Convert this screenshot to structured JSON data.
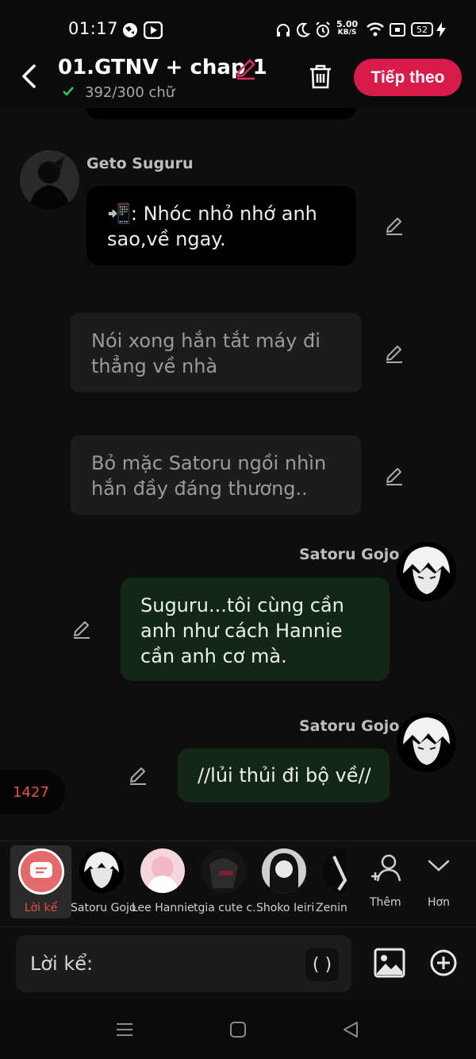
{
  "status_bar": {
    "time": "01:17",
    "net_speed_value": "5.00",
    "net_speed_unit": "KB/S",
    "battery": "52"
  },
  "header": {
    "title": "01.GTNV + chap 1",
    "word_count": "392/300 chữ",
    "next_label": "Tiếp theo"
  },
  "messages": [
    {
      "type": "character",
      "name": "Geto Suguru",
      "text": "📲: Nhóc nhỏ nhớ anh sao,về ngay."
    },
    {
      "type": "narration",
      "text": "Nói xong hắn tắt máy đi thẳng về nhà"
    },
    {
      "type": "narration",
      "text": "Bỏ mặc Satoru ngồi nhìn hắn đầy đáng thương.."
    },
    {
      "type": "self",
      "name": "Satoru Gojo",
      "text": "Suguru...tôi cùng cần anh như cách Hannie cần anh cơ mà."
    },
    {
      "type": "self",
      "name": "Satoru Gojo",
      "text": "//lủi thủi đi bộ về//"
    }
  ],
  "char_count_badge": "1427",
  "characters": [
    {
      "label": "Lời kể"
    },
    {
      "label": "Satoru Gojo"
    },
    {
      "label": "Lee Hannie"
    },
    {
      "label": "tgia cute c..."
    },
    {
      "label": "Shoko Ieiri"
    },
    {
      "label": "Zenin"
    }
  ],
  "actions": {
    "more_label": "Thêm",
    "expand_label": "Hơn"
  },
  "composer": {
    "label": "Lời kể:",
    "paren": "( )"
  },
  "colors": {
    "accent": "#d81b4b",
    "self_bubble": "#142614",
    "narration_bubble": "#1c1c1c"
  }
}
